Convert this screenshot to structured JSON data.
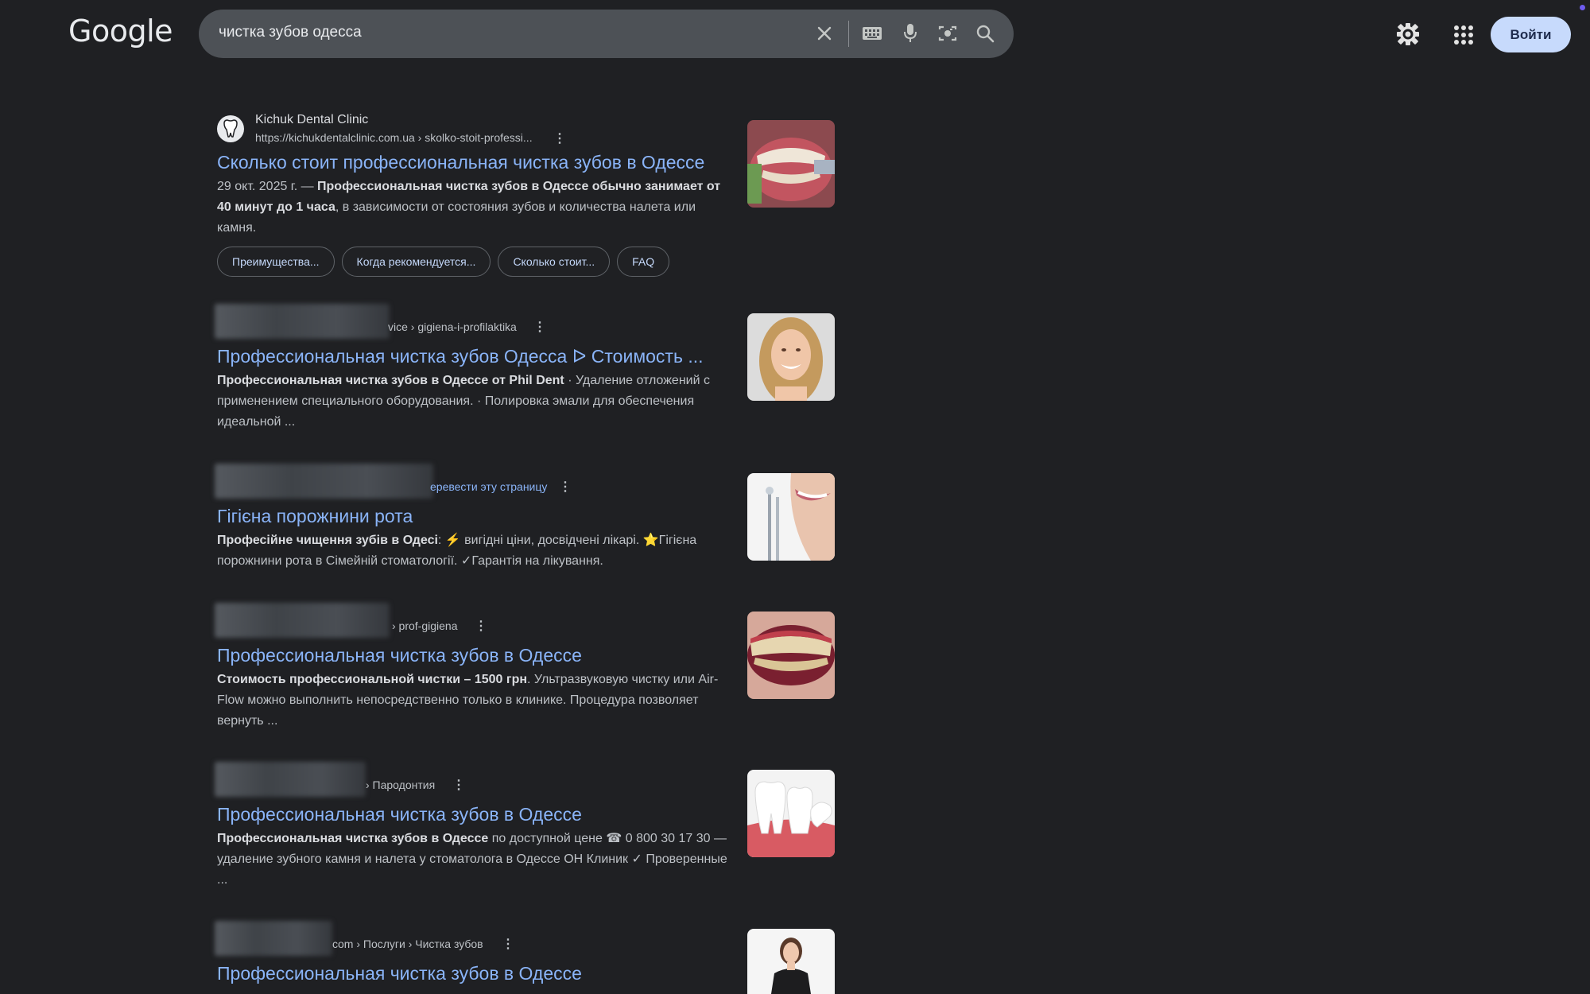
{
  "header": {
    "logo": "Google",
    "search_query": "чистка зубов одесса",
    "login_label": "Войти"
  },
  "icons": {
    "clear": "close-icon",
    "keyboard": "keyboard-icon",
    "voice": "microphone-icon",
    "lens": "camera-icon",
    "search": "search-icon",
    "settings": "gear-icon",
    "apps": "apps-grid-icon"
  },
  "results": [
    {
      "site_name": "Kichuk Dental Clinic",
      "url": "https://kichukdentalclinic.com.ua › skolko-stoit-professi...",
      "title": "Сколько стоит профессиональная чистка зубов в Одессе",
      "date": "29 окт. 2025 г. — ",
      "snippet_bold": "Профессиональная чистка зубов в Одессе обычно занимает от 40 минут до 1 часа",
      "snippet_rest": ", в зависимости от состояния зубов и количества налета или камня.",
      "chips": [
        "Преимущества...",
        "Когда рекомендуется...",
        "Сколько стоит...",
        "FAQ"
      ]
    },
    {
      "crumb": "vice › gigiena-i-profilaktika",
      "title": "Профессиональная чистка зубов Одесса ᐅ Стоимость ...",
      "snippet_bold": "Профессиональная чистка зубов в Одессе от Phil Dent",
      "snippet_rest": " · Удаление отложений с применением специального оборудования. · Полировка эмали для обеспечения идеальной ..."
    },
    {
      "crumb": "еревести эту страницу",
      "title": "Гігієна порожнини рота",
      "snippet_bold": "Професійне чищення зубів в Одесі",
      "snippet_rest": ": ⚡ вигідні ціни, досвідчені лікарі. ⭐Гігієна порожнини рота в Сімейній стоматології. ✓Гарантія на лікування."
    },
    {
      "crumb": "› prof-gigiena",
      "title": "Профессиональная чистка зубов в Одессе",
      "snippet_bold": "Стоимость профессиональной чистки – 1500 грн",
      "snippet_rest": ". Ультразвуковую чистку или Air-Flow можно выполнить непосредственно только в клинике. Процедура позволяет вернуть ..."
    },
    {
      "crumb": "› Пародонтия",
      "title": "Профессиональная чистка зубов в Одессе",
      "snippet_bold": "Профессиональная чистка зубов в Одессе",
      "snippet_rest": " по доступной цене ☎ 0 800 30 17 30 — удаление зубного камня и налета у стоматолога в Одессе ОН Клиник ✓ Проверенные ..."
    },
    {
      "crumb": "com › Послуги › Чистка зубов",
      "title": "Профессиональная чистка зубов в Одессе"
    }
  ]
}
